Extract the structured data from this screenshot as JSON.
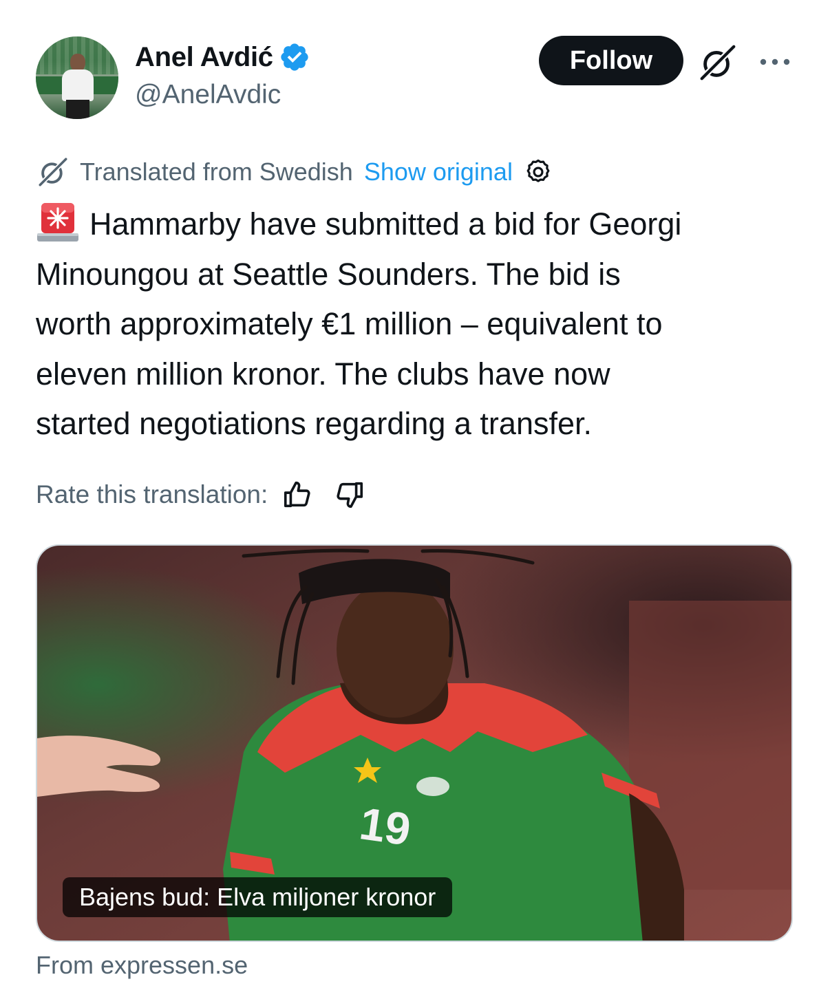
{
  "author": {
    "display_name": "Anel Avdić",
    "handle": "@AnelAvdic",
    "verified": true
  },
  "header": {
    "follow_label": "Follow",
    "grok_icon": "grok-icon",
    "more_icon": "more-options-icon"
  },
  "translation": {
    "notice": "Translated from Swedish",
    "show_original_label": "Show original",
    "settings_icon": "gear-icon"
  },
  "tweet": {
    "emoji": "police-siren",
    "lines": [
      "Hammarby have submitted a bid for Georgi",
      "Minoungou at Seattle Sounders. The bid is",
      "worth approximately €1 million – equivalent to",
      "eleven million kronor. The clubs have now",
      "started negotiations regarding a transfer."
    ]
  },
  "rating": {
    "label": "Rate this translation:",
    "thumbs_up_icon": "thumbs-up-icon",
    "thumbs_down_icon": "thumbs-down-icon"
  },
  "media": {
    "caption": "Bajens bud: Elva miljoner kronor",
    "source": "From expressen.se"
  },
  "colors": {
    "text": "#0f1419",
    "secondary": "#536471",
    "link": "#1d9bf0",
    "verified": "#1d9bf0",
    "button_bg": "#0f1419",
    "card_border": "#cfd9de"
  }
}
